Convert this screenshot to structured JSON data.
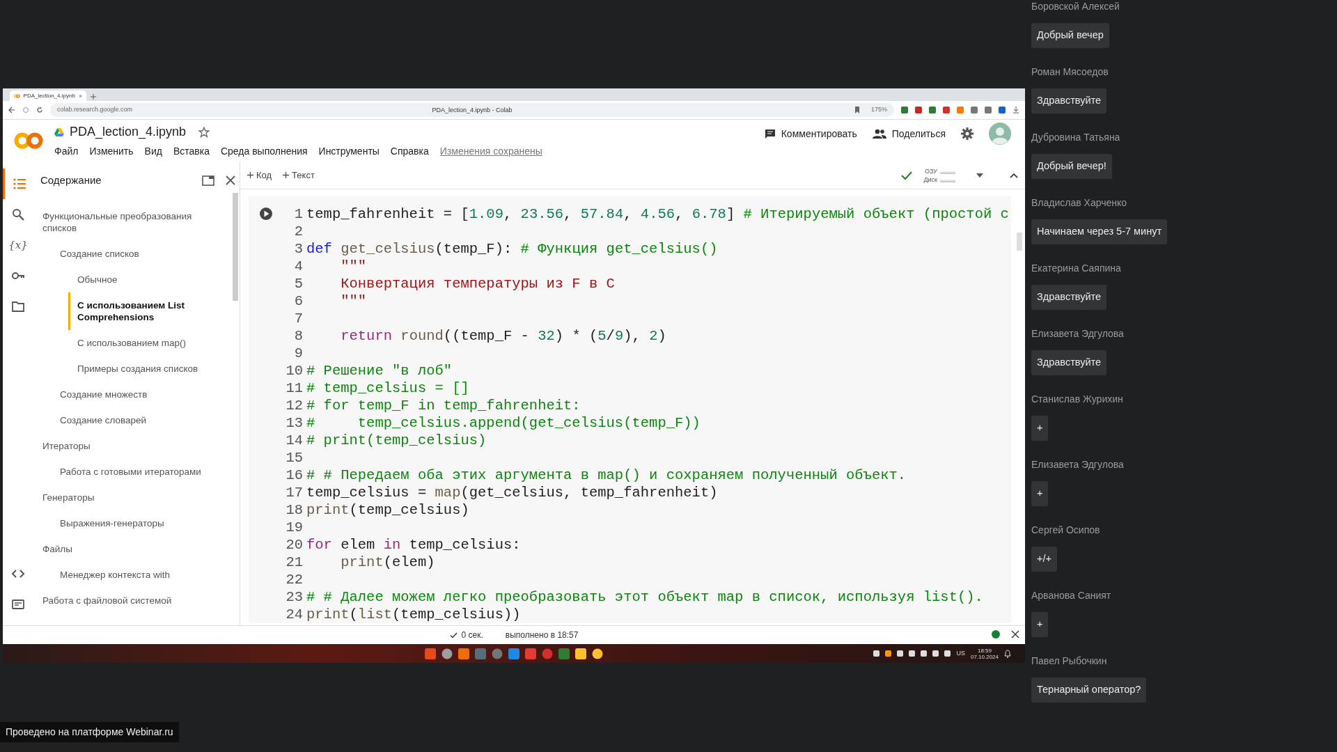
{
  "browser": {
    "tab_title": "PDA_lection_4.ipynb",
    "address": "colab.research.google.com",
    "page_title": "PDA_lection_4.ipynb - Colab",
    "zoom": "175%"
  },
  "notebook": {
    "title": "PDA_lection_4.ipynb",
    "starred": false,
    "menu": [
      "Файл",
      "Изменить",
      "Вид",
      "Вставка",
      "Среда выполнения",
      "Инструменты",
      "Справка"
    ],
    "save_status": "Изменения сохранены",
    "comment": "Комментировать",
    "share": "Поделиться"
  },
  "toolbar": {
    "add_code": "Код",
    "add_text": "Текст",
    "ram": "ОЗУ",
    "disk": "Диск"
  },
  "rail": [
    {
      "kind": "toc",
      "selected": true
    },
    {
      "kind": "search",
      "selected": false
    },
    {
      "kind": "variables",
      "glyph": "{x}",
      "selected": false
    },
    {
      "kind": "key",
      "selected": false
    },
    {
      "kind": "folder",
      "selected": false
    },
    {
      "kind": "code",
      "selected": false
    },
    {
      "kind": "terminal",
      "selected": false
    }
  ],
  "toc": {
    "title": "Содержание",
    "items": [
      {
        "label": "Функциональные преобразования списков",
        "selected": false,
        "children": [
          {
            "label": "Создание списков",
            "selected": false,
            "children": [
              {
                "label": "Обычное",
                "selected": false
              },
              {
                "label": "С использованием List Comprehensions",
                "selected": true
              },
              {
                "label": "С использованием map()",
                "selected": false
              },
              {
                "label": "Примеры создания списков",
                "selected": false
              }
            ]
          },
          {
            "label": "Создание множеств",
            "selected": false
          },
          {
            "label": "Создание словарей",
            "selected": false
          }
        ]
      },
      {
        "label": "Итераторы",
        "selected": false,
        "children": [
          {
            "label": "Работа с готовыми итераторами",
            "selected": false
          }
        ]
      },
      {
        "label": "Генераторы",
        "selected": false,
        "children": [
          {
            "label": "Выражения-генераторы",
            "selected": false
          }
        ]
      },
      {
        "label": "Файлы",
        "selected": false,
        "children": [
          {
            "label": "Менеджер контекста with",
            "selected": false
          }
        ]
      },
      {
        "label": "Работа с файловой системой",
        "selected": false
      }
    ]
  },
  "cell": {
    "lines": [
      {
        "number": "1",
        "tokens": [
          {
            "text": "temp_fahrenheit = [",
            "kind": "plain"
          },
          {
            "text": "1.09",
            "kind": "number"
          },
          {
            "text": ", ",
            "kind": "plain"
          },
          {
            "text": "23.56",
            "kind": "number"
          },
          {
            "text": ", ",
            "kind": "plain"
          },
          {
            "text": "57.84",
            "kind": "number"
          },
          {
            "text": ", ",
            "kind": "plain"
          },
          {
            "text": "4.56",
            "kind": "number"
          },
          {
            "text": ", ",
            "kind": "plain"
          },
          {
            "text": "6.78",
            "kind": "number"
          },
          {
            "text": "] ",
            "kind": "plain"
          },
          {
            "text": "# Итерируемый объект (простой с",
            "kind": "comment"
          }
        ]
      },
      {
        "number": "2"
      },
      {
        "number": "3",
        "tokens": [
          {
            "text": "def ",
            "kind": "keyword"
          },
          {
            "text": "get_celsius",
            "kind": "function"
          },
          {
            "text": "(temp_F): ",
            "kind": "plain"
          },
          {
            "text": "# Функция get_celsius()",
            "kind": "comment"
          }
        ]
      },
      {
        "number": "4",
        "tokens": [
          {
            "text": "    \"\"\"",
            "kind": "string"
          }
        ]
      },
      {
        "number": "5",
        "tokens": [
          {
            "text": "    Конвертация температуры из F в C",
            "kind": "string"
          }
        ]
      },
      {
        "number": "6",
        "tokens": [
          {
            "text": "    \"\"\"",
            "kind": "string"
          }
        ]
      },
      {
        "number": "7"
      },
      {
        "number": "8",
        "tokens": [
          {
            "text": "    return ",
            "kind": "control"
          },
          {
            "text": "round",
            "kind": "function"
          },
          {
            "text": "((temp_F - ",
            "kind": "plain"
          },
          {
            "text": "32",
            "kind": "number"
          },
          {
            "text": ") * (",
            "kind": "plain"
          },
          {
            "text": "5",
            "kind": "number"
          },
          {
            "text": "/",
            "kind": "plain"
          },
          {
            "text": "9",
            "kind": "number"
          },
          {
            "text": "), ",
            "kind": "plain"
          },
          {
            "text": "2",
            "kind": "number"
          },
          {
            "text": ")",
            "kind": "plain"
          }
        ]
      },
      {
        "number": "9"
      },
      {
        "number": "10",
        "tokens": [
          {
            "text": "# Решение \"в лоб\"",
            "kind": "comment"
          }
        ]
      },
      {
        "number": "11",
        "tokens": [
          {
            "text": "# temp_celsius = []",
            "kind": "comment"
          }
        ]
      },
      {
        "number": "12",
        "tokens": [
          {
            "text": "# for temp_F in temp_fahrenheit:",
            "kind": "comment"
          }
        ]
      },
      {
        "number": "13",
        "tokens": [
          {
            "text": "#     temp_celsius.append(get_celsius(temp_F))",
            "kind": "comment"
          }
        ]
      },
      {
        "number": "14",
        "tokens": [
          {
            "text": "# print(temp_celsius)",
            "kind": "comment"
          }
        ]
      },
      {
        "number": "15"
      },
      {
        "number": "16",
        "tokens": [
          {
            "text": "# # Передаем оба этих аргумента в map() и сохраняем полученный объект.",
            "kind": "comment"
          }
        ]
      },
      {
        "number": "17",
        "tokens": [
          {
            "text": "temp_celsius = ",
            "kind": "plain"
          },
          {
            "text": "map",
            "kind": "function"
          },
          {
            "text": "(get_celsius, temp_fahrenheit)",
            "kind": "plain"
          }
        ]
      },
      {
        "number": "18",
        "tokens": [
          {
            "text": "print",
            "kind": "function"
          },
          {
            "text": "(temp_celsius)",
            "kind": "plain"
          }
        ]
      },
      {
        "number": "19"
      },
      {
        "number": "20",
        "tokens": [
          {
            "text": "for",
            "kind": "control"
          },
          {
            "text": " elem ",
            "kind": "plain"
          },
          {
            "text": "in",
            "kind": "control"
          },
          {
            "text": " temp_celsius:",
            "kind": "plain"
          }
        ]
      },
      {
        "number": "21",
        "tokens": [
          {
            "text": "    print",
            "kind": "function"
          },
          {
            "text": "(elem)",
            "kind": "plain"
          }
        ]
      },
      {
        "number": "22"
      },
      {
        "number": "23",
        "tokens": [
          {
            "text": "# # Далее можем легко преобразовать этот объект map в список, используя list().",
            "kind": "comment"
          }
        ]
      },
      {
        "number": "24",
        "tokens": [
          {
            "text": "print",
            "kind": "function"
          },
          {
            "text": "(",
            "kind": "plain"
          },
          {
            "text": "list",
            "kind": "function"
          },
          {
            "text": "(temp_celsius))",
            "kind": "plain"
          }
        ]
      }
    ]
  },
  "status_bar": {
    "duration": "0 сек.",
    "executed": "выполнено в 18:57",
    "connected": true
  },
  "taskbar": {
    "keyboard": "US",
    "time": "18:59",
    "date": "07.10.2024"
  },
  "chat": [
    {
      "author": "Боровской Алексей",
      "text": "Добрый вечер"
    },
    {
      "author": "Роман Мясоедов",
      "text": "Здравствуйте"
    },
    {
      "author": "Дубровина Татьяна",
      "text": "Добрый вечер!"
    },
    {
      "author": "Владислав Харченко",
      "text": "Начинаем через 5-7 минут"
    },
    {
      "author": "Екатерина Саяпина",
      "text": "Здравствуйте"
    },
    {
      "author": "Елизавета Эдгулова",
      "text": "Здравствуйте"
    },
    {
      "author": "Станислав Журихин",
      "text": "+"
    },
    {
      "author": "Елизавета Эдгулова",
      "text": "+"
    },
    {
      "author": "Сергей Осипов",
      "text": "+/+"
    },
    {
      "author": "Арванова Саният",
      "text": "+"
    },
    {
      "author": "Павел Рыбочкин",
      "text": "Тернарный оператор?"
    }
  ],
  "platform_note": "Проведено на платформе Webinar.ru"
}
